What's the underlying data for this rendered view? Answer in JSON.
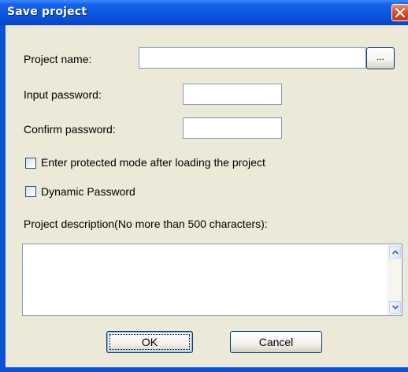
{
  "window": {
    "title": "Save project",
    "close_icon": "close-x-icon"
  },
  "form": {
    "project_name_label": "Project name:",
    "project_name_value": "",
    "browse_label": "...",
    "input_password_label": "Input password:",
    "input_password_value": "",
    "confirm_password_label": "Confirm password:",
    "confirm_password_value": "",
    "protected_mode_label": "Enter protected mode after loading the project",
    "protected_mode_checked": false,
    "dynamic_password_label": "Dynamic Password",
    "dynamic_password_checked": false,
    "description_label": "Project description(No more than 500 characters):",
    "description_value": ""
  },
  "buttons": {
    "ok_label": "OK",
    "cancel_label": "Cancel"
  },
  "colors": {
    "titlebar": "#0a55de",
    "client_bg": "#ece9d8",
    "close_button": "#e0451f",
    "input_border": "#7f9db9"
  }
}
